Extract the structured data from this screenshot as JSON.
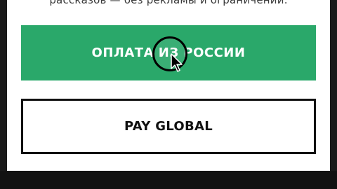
{
  "intro": {
    "text": "рассказов — без рекламы и ограничений."
  },
  "buttons": {
    "pay_russia_label": "ОПЛАТА ИЗ РОССИИ",
    "pay_global_label": "PAY GLOBAL"
  },
  "colors": {
    "accent_green": "#2aa86a",
    "outline_black": "#111111"
  },
  "icons": {
    "cursor": "mouse-pointer-icon",
    "click_indicator": "click-ring-icon"
  }
}
